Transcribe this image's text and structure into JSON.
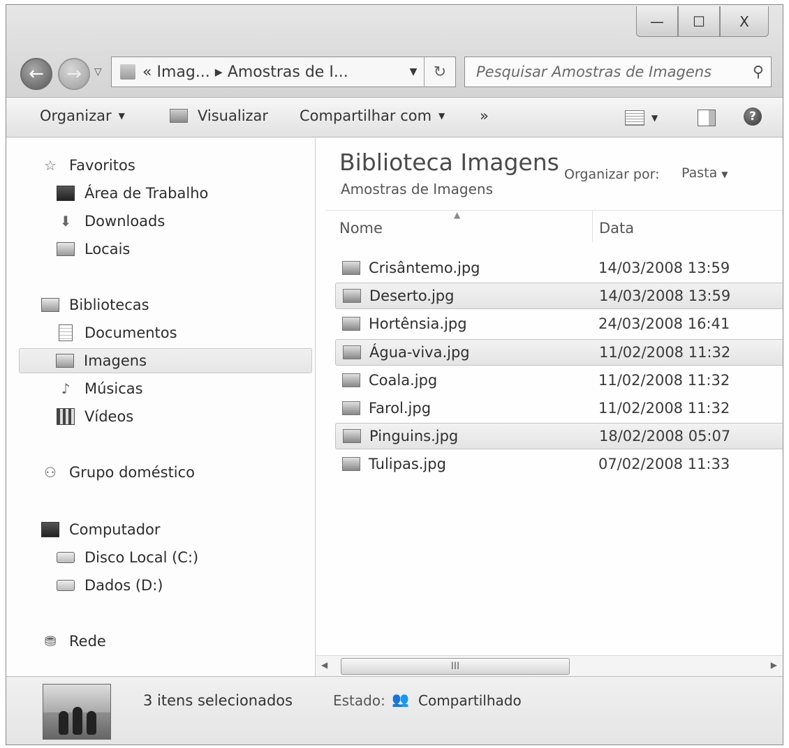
{
  "window": {
    "minimize": "—",
    "maximize": "☐",
    "close": "X"
  },
  "address": {
    "path": "« Imag... ▸ Amostras de I..."
  },
  "search": {
    "placeholder": "Pesquisar Amostras de Imagens"
  },
  "toolbar": {
    "organize": "Organizar",
    "view": "Visualizar",
    "share": "Compartilhar com",
    "more": "»"
  },
  "navpane": {
    "favorites": "Favoritos",
    "desktop": "Área de Trabalho",
    "downloads": "Downloads",
    "places": "Locais",
    "libraries": "Bibliotecas",
    "documents": "Documentos",
    "images": "Imagens",
    "music": "Músicas",
    "videos": "Vídeos",
    "homegroup": "Grupo doméstico",
    "computer": "Computador",
    "disk_c": "Disco Local (C:)",
    "disk_d": "Dados (D:)",
    "network": "Rede"
  },
  "content": {
    "title": "Biblioteca Imagens",
    "subtitle": "Amostras de Imagens",
    "arrange_label": "Organizar por:",
    "arrange_value": "Pasta",
    "columns": {
      "name": "Nome",
      "date": "Data"
    },
    "files": [
      {
        "name": "Crisântemo.jpg",
        "date": "14/03/2008 13:59",
        "selected": false
      },
      {
        "name": "Deserto.jpg",
        "date": "14/03/2008 13:59",
        "selected": true
      },
      {
        "name": "Hortênsia.jpg",
        "date": "24/03/2008 16:41",
        "selected": false
      },
      {
        "name": "Água-viva.jpg",
        "date": "11/02/2008 11:32",
        "selected": true
      },
      {
        "name": "Coala.jpg",
        "date": "11/02/2008 11:32",
        "selected": false
      },
      {
        "name": "Farol.jpg",
        "date": "11/02/2008 11:32",
        "selected": false
      },
      {
        "name": "Pinguins.jpg",
        "date": "18/02/2008 05:07",
        "selected": true
      },
      {
        "name": "Tulipas.jpg",
        "date": "07/02/2008 11:33",
        "selected": false
      }
    ],
    "scroll_thumb": "III"
  },
  "details": {
    "selection": "3 itens selecionados",
    "state_label": "Estado:",
    "state_value": "Compartilhado"
  }
}
